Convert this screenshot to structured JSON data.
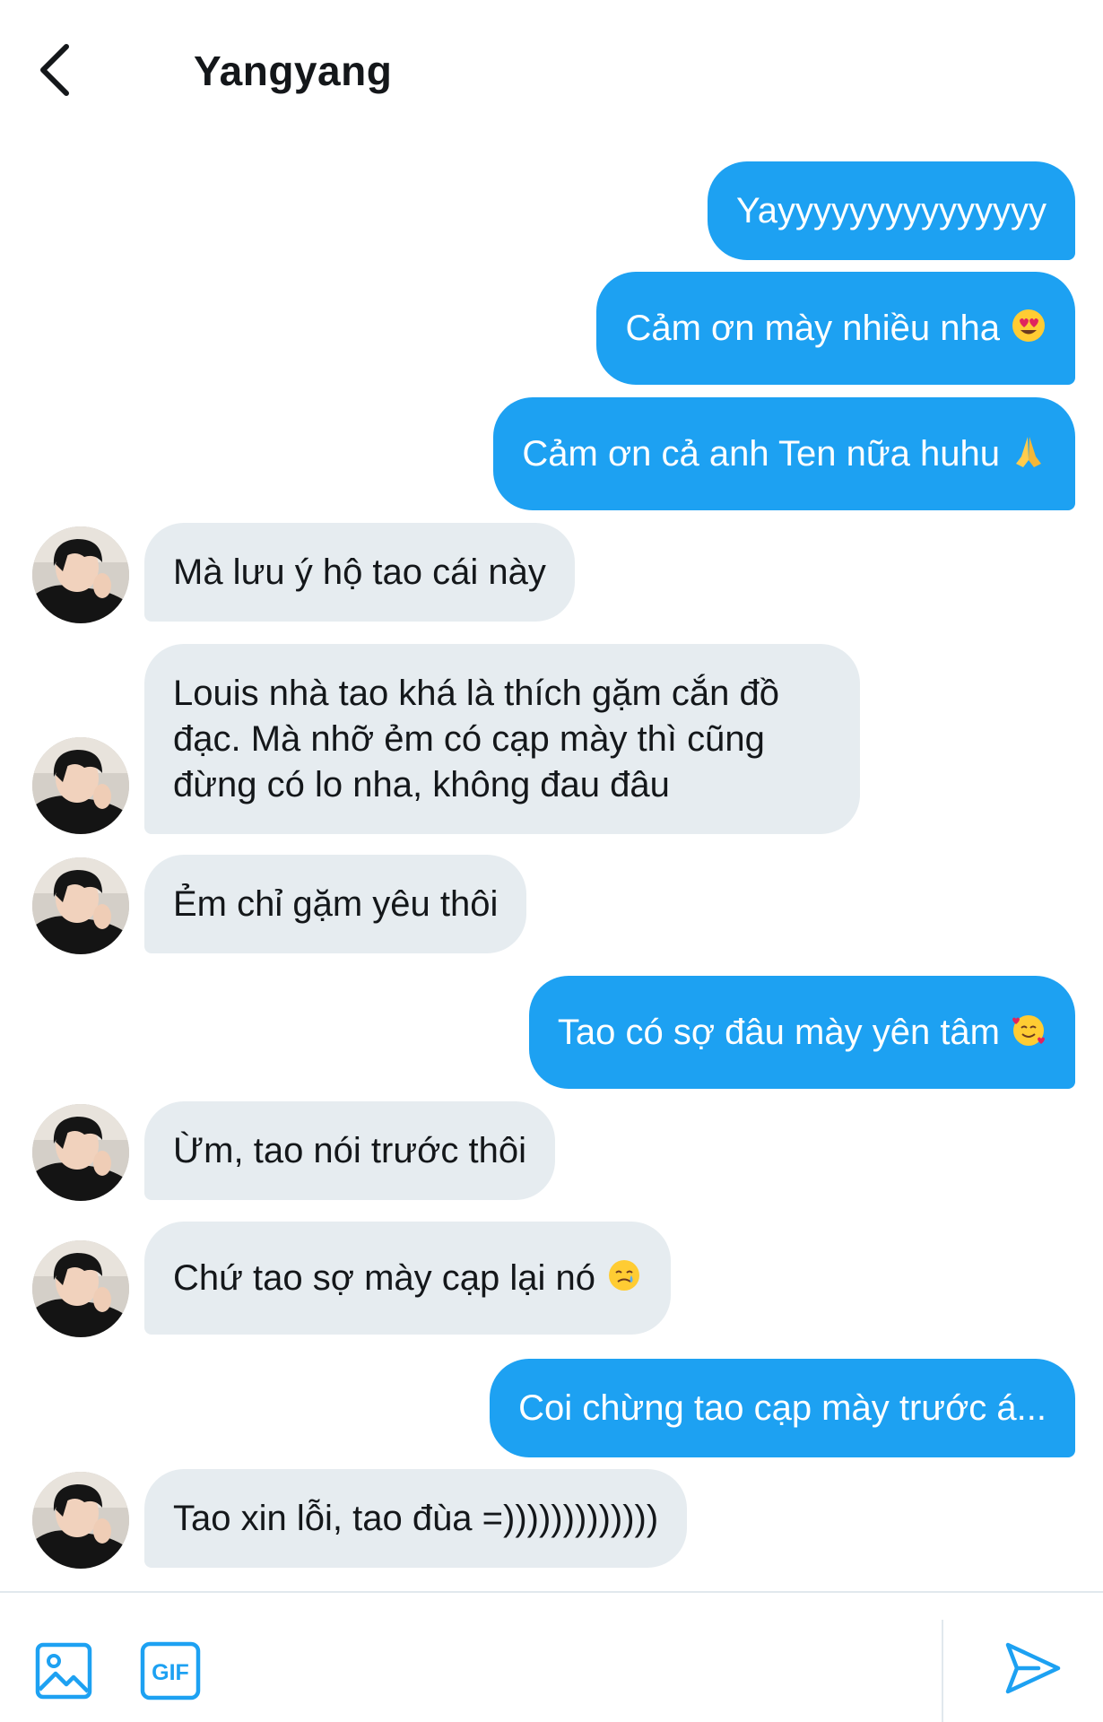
{
  "header": {
    "title": "Yangyang"
  },
  "colors": {
    "outgoing_bubble": "#1da1f2",
    "incoming_bubble": "#e6ecf0",
    "accent": "#1da1f2"
  },
  "messages": [
    {
      "direction": "outgoing",
      "text": "Yayyyyyyyyyyyyyyy",
      "emoji": ""
    },
    {
      "direction": "outgoing",
      "text": "Cảm ơn mày nhiều nha",
      "emoji": "heart-eyes"
    },
    {
      "direction": "outgoing",
      "text": "Cảm ơn cả anh Ten nữa huhu",
      "emoji": "folded-hands"
    },
    {
      "direction": "incoming",
      "text": "Mà lưu ý hộ tao cái này",
      "emoji": ""
    },
    {
      "direction": "incoming",
      "text": "Louis nhà tao khá là thích gặm cắn đồ đạc. Mà nhỡ ẻm có cạp mày thì cũng đừng có lo nha, không đau đâu",
      "emoji": ""
    },
    {
      "direction": "incoming",
      "text": "Ẻm chỉ gặm yêu thôi",
      "emoji": ""
    },
    {
      "direction": "outgoing",
      "text": "Tao có sợ đâu mày yên tâm",
      "emoji": "smiling-hearts"
    },
    {
      "direction": "incoming",
      "text": "Ừm, tao nói trước thôi",
      "emoji": ""
    },
    {
      "direction": "incoming",
      "text": "Chứ tao sợ mày cạp lại nó",
      "emoji": "smiling-tear"
    },
    {
      "direction": "outgoing",
      "text": "Coi chừng tao cạp mày trước á...",
      "emoji": ""
    },
    {
      "direction": "incoming",
      "text": "Tao xin lỗi, tao đùa =)))))))))))))",
      "emoji": ""
    }
  ],
  "composer": {
    "image_icon": "image-icon",
    "gif_icon": "gif-icon",
    "gif_label": "GIF",
    "send_icon": "send-icon"
  }
}
